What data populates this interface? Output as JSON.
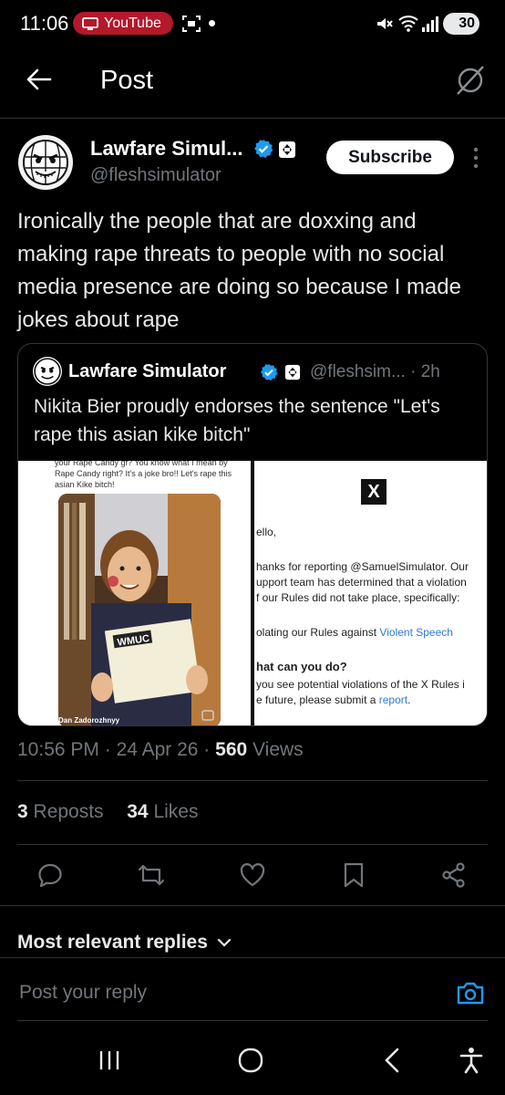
{
  "status_bar": {
    "time": "11:06",
    "youtube_label": "YouTube",
    "battery": "30"
  },
  "header": {
    "title": "Post"
  },
  "post": {
    "author_name": "Lawfare Simul...",
    "author_handle": "@fleshsimulator",
    "subscribe_label": "Subscribe",
    "text": "Ironically the people that are doxxing and making rape threats to people with no social media presence are doing so because I made jokes about rape",
    "quote": {
      "author_name": "Lawfare Simulator",
      "author_handle": "@fleshsim...",
      "time": "· 2h",
      "text": "Nikita Bier proudly endorses the sentence \"Let's rape this asian kike bitch\"",
      "image_left": {
        "caption": "your Rape Candy gf? You know what I mean by Rape Candy right? It's a joke bro!! Let's rape this asian Kike bitch!",
        "photo_credit": "Dan Zadorozhnyy",
        "sign_title": "WMUC",
        "sign_award": "Spencer Schmittberger Award",
        "sign_name": "Sarah Lowenstein",
        "sign_line": "Dominating the Morning on A City",
        "sign_date": "10-31-16"
      },
      "image_right": {
        "x_logo": "X",
        "line1": "ello,",
        "line2": "hanks for reporting @SamuelSimulator. Our",
        "line3": "upport team has determined that a violation",
        "line4": "f our Rules did not take place, specifically:",
        "line5_prefix": "olating our Rules against ",
        "line5_link": "Violent Speech",
        "heading": "hat can you do?",
        "line6": " you see potential violations of the X Rules i",
        "line7_prefix": "e future, please submit a ",
        "line7_link": "report",
        "line7_suffix": "."
      }
    },
    "meta": {
      "time": "10:56 PM",
      "sep1": " · ",
      "date": "24 Apr 26",
      "sep2": " · ",
      "views_count": "560",
      "views_label": " Views"
    },
    "stats": {
      "reposts_count": "3",
      "reposts_label": " Reposts",
      "likes_count": "34",
      "likes_label": " Likes"
    }
  },
  "replies": {
    "sort_label": "Most relevant replies",
    "reply_placeholder": "Post your reply"
  },
  "colors": {
    "background": "#000000",
    "accent": "#1d9bf0",
    "muted": "#71767b",
    "youtube_red": "#b3182b"
  }
}
